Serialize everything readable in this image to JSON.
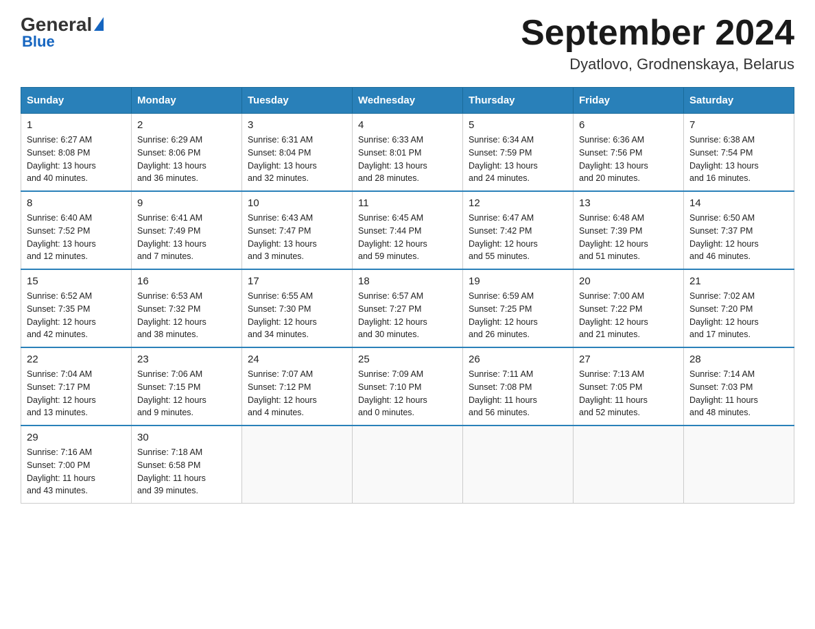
{
  "header": {
    "logo": {
      "general": "General",
      "blue": "Blue"
    },
    "title": "September 2024",
    "location": "Dyatlovo, Grodnenskaya, Belarus"
  },
  "days_of_week": [
    "Sunday",
    "Monday",
    "Tuesday",
    "Wednesday",
    "Thursday",
    "Friday",
    "Saturday"
  ],
  "weeks": [
    [
      {
        "day": "1",
        "sunrise": "6:27 AM",
        "sunset": "8:08 PM",
        "daylight": "13 hours and 40 minutes."
      },
      {
        "day": "2",
        "sunrise": "6:29 AM",
        "sunset": "8:06 PM",
        "daylight": "13 hours and 36 minutes."
      },
      {
        "day": "3",
        "sunrise": "6:31 AM",
        "sunset": "8:04 PM",
        "daylight": "13 hours and 32 minutes."
      },
      {
        "day": "4",
        "sunrise": "6:33 AM",
        "sunset": "8:01 PM",
        "daylight": "13 hours and 28 minutes."
      },
      {
        "day": "5",
        "sunrise": "6:34 AM",
        "sunset": "7:59 PM",
        "daylight": "13 hours and 24 minutes."
      },
      {
        "day": "6",
        "sunrise": "6:36 AM",
        "sunset": "7:56 PM",
        "daylight": "13 hours and 20 minutes."
      },
      {
        "day": "7",
        "sunrise": "6:38 AM",
        "sunset": "7:54 PM",
        "daylight": "13 hours and 16 minutes."
      }
    ],
    [
      {
        "day": "8",
        "sunrise": "6:40 AM",
        "sunset": "7:52 PM",
        "daylight": "13 hours and 12 minutes."
      },
      {
        "day": "9",
        "sunrise": "6:41 AM",
        "sunset": "7:49 PM",
        "daylight": "13 hours and 7 minutes."
      },
      {
        "day": "10",
        "sunrise": "6:43 AM",
        "sunset": "7:47 PM",
        "daylight": "13 hours and 3 minutes."
      },
      {
        "day": "11",
        "sunrise": "6:45 AM",
        "sunset": "7:44 PM",
        "daylight": "12 hours and 59 minutes."
      },
      {
        "day": "12",
        "sunrise": "6:47 AM",
        "sunset": "7:42 PM",
        "daylight": "12 hours and 55 minutes."
      },
      {
        "day": "13",
        "sunrise": "6:48 AM",
        "sunset": "7:39 PM",
        "daylight": "12 hours and 51 minutes."
      },
      {
        "day": "14",
        "sunrise": "6:50 AM",
        "sunset": "7:37 PM",
        "daylight": "12 hours and 46 minutes."
      }
    ],
    [
      {
        "day": "15",
        "sunrise": "6:52 AM",
        "sunset": "7:35 PM",
        "daylight": "12 hours and 42 minutes."
      },
      {
        "day": "16",
        "sunrise": "6:53 AM",
        "sunset": "7:32 PM",
        "daylight": "12 hours and 38 minutes."
      },
      {
        "day": "17",
        "sunrise": "6:55 AM",
        "sunset": "7:30 PM",
        "daylight": "12 hours and 34 minutes."
      },
      {
        "day": "18",
        "sunrise": "6:57 AM",
        "sunset": "7:27 PM",
        "daylight": "12 hours and 30 minutes."
      },
      {
        "day": "19",
        "sunrise": "6:59 AM",
        "sunset": "7:25 PM",
        "daylight": "12 hours and 26 minutes."
      },
      {
        "day": "20",
        "sunrise": "7:00 AM",
        "sunset": "7:22 PM",
        "daylight": "12 hours and 21 minutes."
      },
      {
        "day": "21",
        "sunrise": "7:02 AM",
        "sunset": "7:20 PM",
        "daylight": "12 hours and 17 minutes."
      }
    ],
    [
      {
        "day": "22",
        "sunrise": "7:04 AM",
        "sunset": "7:17 PM",
        "daylight": "12 hours and 13 minutes."
      },
      {
        "day": "23",
        "sunrise": "7:06 AM",
        "sunset": "7:15 PM",
        "daylight": "12 hours and 9 minutes."
      },
      {
        "day": "24",
        "sunrise": "7:07 AM",
        "sunset": "7:12 PM",
        "daylight": "12 hours and 4 minutes."
      },
      {
        "day": "25",
        "sunrise": "7:09 AM",
        "sunset": "7:10 PM",
        "daylight": "12 hours and 0 minutes."
      },
      {
        "day": "26",
        "sunrise": "7:11 AM",
        "sunset": "7:08 PM",
        "daylight": "11 hours and 56 minutes."
      },
      {
        "day": "27",
        "sunrise": "7:13 AM",
        "sunset": "7:05 PM",
        "daylight": "11 hours and 52 minutes."
      },
      {
        "day": "28",
        "sunrise": "7:14 AM",
        "sunset": "7:03 PM",
        "daylight": "11 hours and 48 minutes."
      }
    ],
    [
      {
        "day": "29",
        "sunrise": "7:16 AM",
        "sunset": "7:00 PM",
        "daylight": "11 hours and 43 minutes."
      },
      {
        "day": "30",
        "sunrise": "7:18 AM",
        "sunset": "6:58 PM",
        "daylight": "11 hours and 39 minutes."
      },
      null,
      null,
      null,
      null,
      null
    ]
  ],
  "labels": {
    "sunrise": "Sunrise:",
    "sunset": "Sunset:",
    "daylight": "Daylight:"
  }
}
